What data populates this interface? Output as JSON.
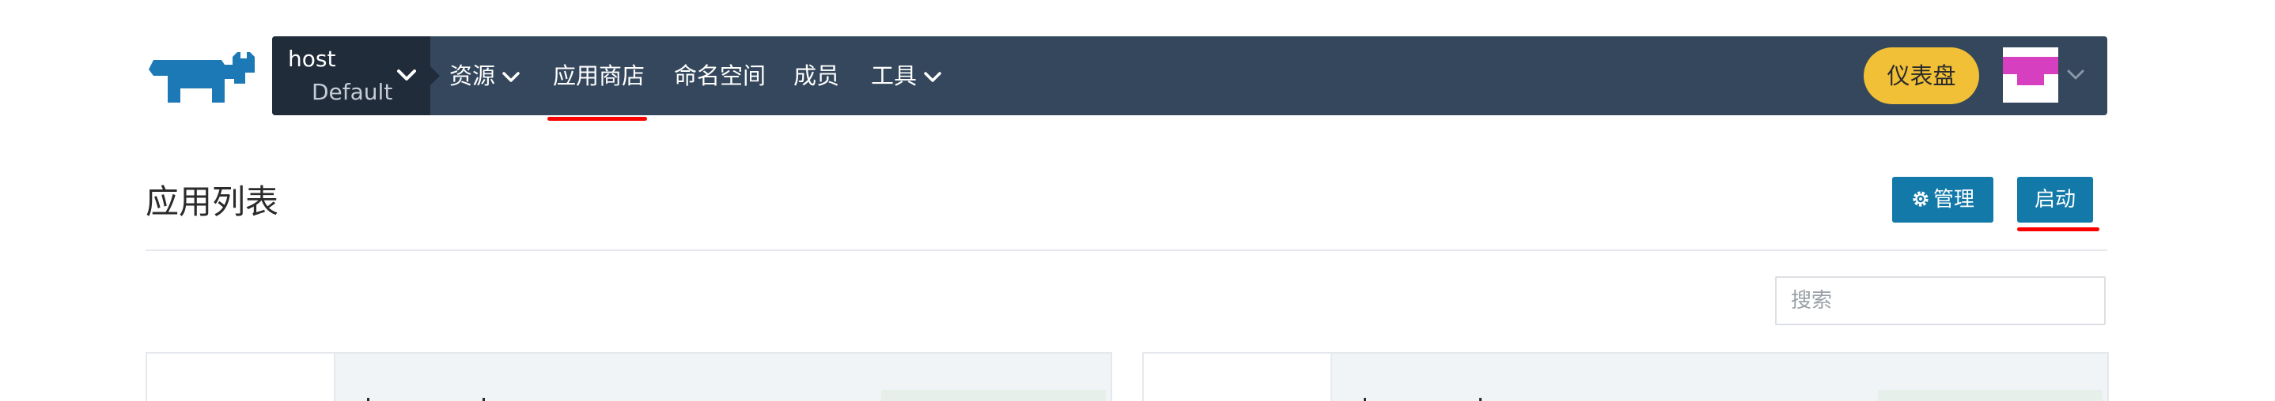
{
  "navbar": {
    "cluster": "host",
    "project": "Default",
    "items": [
      {
        "label": "资源",
        "has_dropdown": true
      },
      {
        "label": "应用商店",
        "has_dropdown": false,
        "annotated": true
      },
      {
        "label": "命名空间",
        "has_dropdown": false
      },
      {
        "label": "成员",
        "has_dropdown": false
      },
      {
        "label": "工具",
        "has_dropdown": true
      }
    ],
    "dashboard_label": "仪表盘",
    "colors": {
      "bar": "#35475c",
      "env_switcher": "#202c3a",
      "dashboard": "#f1c037",
      "avatar": "#d63fbf"
    },
    "icons": {
      "logo": "rancher-logo",
      "dropdown": "chevron-down-icon",
      "avatar": "identicon-avatar"
    }
  },
  "page": {
    "title": "应用列表",
    "manage_label": "管理",
    "launch_label": "启动",
    "search_placeholder": "搜索",
    "colors": {
      "primary_button": "#1279a8",
      "annotation": "#ff0000"
    }
  }
}
